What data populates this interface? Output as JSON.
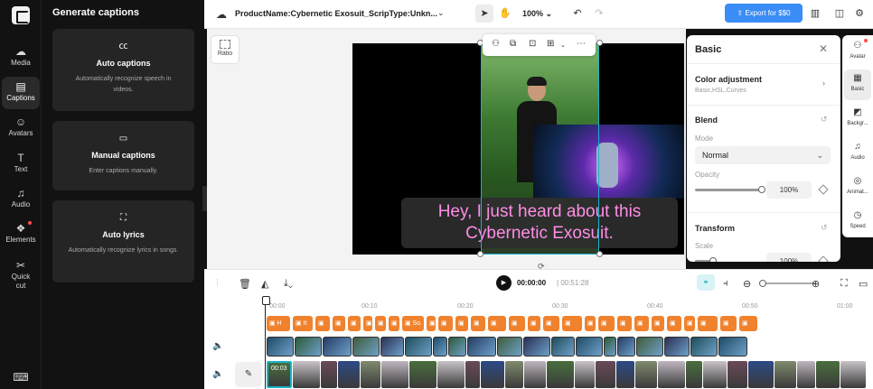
{
  "left_rail": {
    "items": [
      {
        "key": "media",
        "label": "Media",
        "icon": "cloud-upload-icon"
      },
      {
        "key": "captions",
        "label": "Captions",
        "icon": "captions-icon"
      },
      {
        "key": "avatars",
        "label": "Avatars",
        "icon": "avatar-icon"
      },
      {
        "key": "text",
        "label": "Text",
        "icon": "text-icon"
      },
      {
        "key": "audio",
        "label": "Audio",
        "icon": "music-note-icon"
      },
      {
        "key": "elements",
        "label": "Elements",
        "icon": "elements-icon"
      },
      {
        "key": "quick_cut",
        "label": "Quick cut",
        "icon": "quick-cut-icon"
      }
    ],
    "active": "captions"
  },
  "captions_panel": {
    "title": "Generate captions",
    "cards": [
      {
        "title": "Auto captions",
        "description": "Automatically recognize speech in videos.",
        "icon": "cc-icon"
      },
      {
        "title": "Manual captions",
        "description": "Enter captions manually.",
        "icon": "keyboard-icon"
      },
      {
        "title": "Auto lyrics",
        "description": "Automatically recognize lyrics in songs.",
        "icon": "lyrics-scan-icon"
      }
    ]
  },
  "topbar": {
    "project_title": "ProductName:Cybernetic Exosuit_ScripType:Unkn...",
    "zoom": "100%",
    "export_label": "Export for $$0"
  },
  "canvas": {
    "ratio_label": "Ratio",
    "caption_text": "Hey, I just heard about this Cybernetic Exosuit."
  },
  "props": {
    "title": "Basic",
    "color_adjustment": {
      "title": "Color adjustment",
      "subtitle": "Basic,HSL,Curves"
    },
    "blend": {
      "title": "Blend",
      "mode_label": "Mode",
      "mode_value": "Normal",
      "opacity_label": "Opacity",
      "opacity_value": "100%"
    },
    "transform": {
      "title": "Transform",
      "scale_label": "Scale",
      "scale_value": "100%"
    }
  },
  "right_tabs": [
    {
      "label": "Avatar",
      "icon": "avatar-icon"
    },
    {
      "label": "Basic",
      "icon": "basic-icon"
    },
    {
      "label": "Backgr...",
      "icon": "background-icon"
    },
    {
      "label": "Audio",
      "icon": "audio-icon"
    },
    {
      "label": "Animat...",
      "icon": "animation-icon"
    },
    {
      "label": "Speed",
      "icon": "speed-icon"
    }
  ],
  "timeline": {
    "current_time": "00:00:00",
    "total_time": "00:51:28",
    "ruler": [
      "00:00",
      "00:10",
      "00:20",
      "00:30",
      "00:40",
      "00:50",
      "01:00"
    ],
    "clip_time": "00:03",
    "caption_clips": [
      "H",
      "It",
      "",
      "",
      "",
      "",
      "",
      "",
      "So.",
      "",
      "",
      "",
      "",
      "",
      "",
      "",
      "",
      "",
      "",
      "",
      "",
      "",
      "",
      "",
      "",
      "",
      "",
      "",
      ""
    ]
  },
  "colors": {
    "accent": "#3a8cf6",
    "caption_clip": "#f0822e",
    "selection": "#19b3c9",
    "caption_text": "#ff8de6"
  }
}
